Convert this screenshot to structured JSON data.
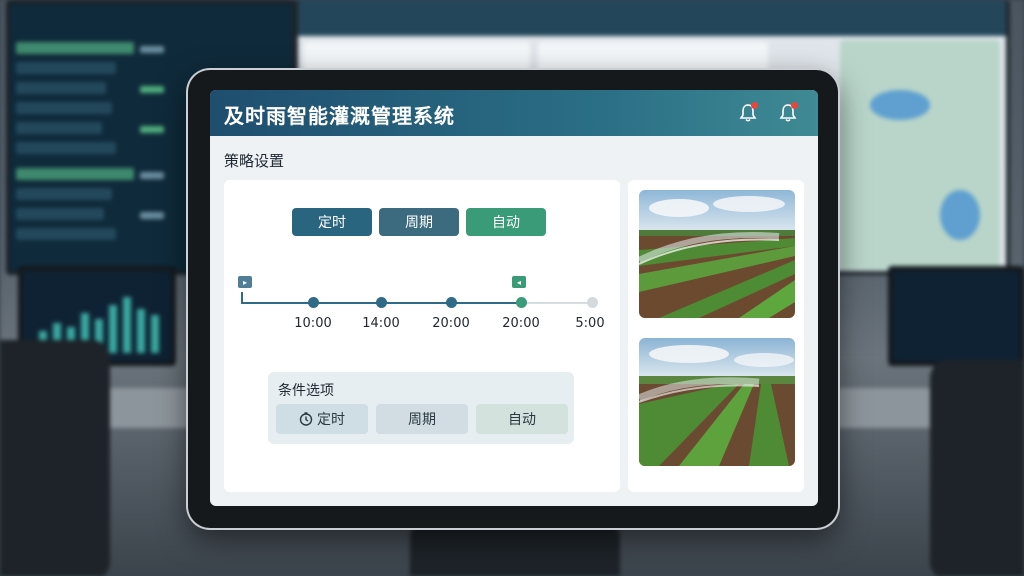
{
  "app": {
    "title": "及时雨智能灌溉管理系统"
  },
  "page": {
    "section_title": "策略设置"
  },
  "mode_buttons": [
    {
      "label": "定时"
    },
    {
      "label": "周期"
    },
    {
      "label": "自动"
    }
  ],
  "timeline": {
    "labels": [
      "10:00",
      "14:00",
      "20:00",
      "20:00",
      "5:00"
    ]
  },
  "conditions": {
    "title": "条件选项",
    "options": [
      {
        "label": "定时",
        "icon": "clock-icon"
      },
      {
        "label": "周期"
      },
      {
        "label": "自动"
      }
    ]
  },
  "colors": {
    "header_start": "#1f4e6e",
    "header_end": "#3f8a94",
    "primary": "#2a6580",
    "accent_green": "#3a9b78",
    "notification": "#e8453c"
  }
}
